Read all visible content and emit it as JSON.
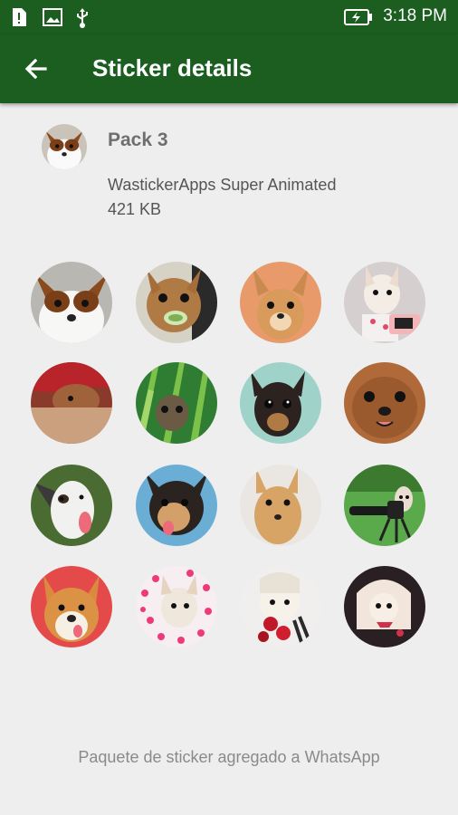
{
  "status_bar": {
    "time": "3:18 PM",
    "left_icons": [
      "sim-card-alert-icon",
      "image-icon",
      "usb-icon"
    ],
    "right_icons": [
      "battery-charging-icon"
    ]
  },
  "app_bar": {
    "back_icon": "arrow-left-icon",
    "title": "Sticker details",
    "background_color": "#1b5e20"
  },
  "pack": {
    "name": "Pack 3",
    "publisher": "WastickerApps Super Animated",
    "size": "421 KB"
  },
  "stickers": [
    {
      "name": "sticker-papillon"
    },
    {
      "name": "sticker-chihuahua-eating"
    },
    {
      "name": "sticker-chihuahua-tan"
    },
    {
      "name": "sticker-chihuahua-laptop"
    },
    {
      "name": "sticker-dog-red-blanket"
    },
    {
      "name": "sticker-chihuahua-grass"
    },
    {
      "name": "sticker-chihuahua-black"
    },
    {
      "name": "sticker-chihuahua-closeup"
    },
    {
      "name": "sticker-greyhound-tongue"
    },
    {
      "name": "sticker-chihuahua-tongue"
    },
    {
      "name": "sticker-chihuahua-stare"
    },
    {
      "name": "sticker-dog-camera"
    },
    {
      "name": "sticker-corgi"
    },
    {
      "name": "sticker-chihuahua-hearts"
    },
    {
      "name": "sticker-chihuahua-roses"
    },
    {
      "name": "sticker-chihuahua-wig"
    }
  ],
  "footer": {
    "status_text": "Paquete de sticker agregado a WhatsApp"
  }
}
